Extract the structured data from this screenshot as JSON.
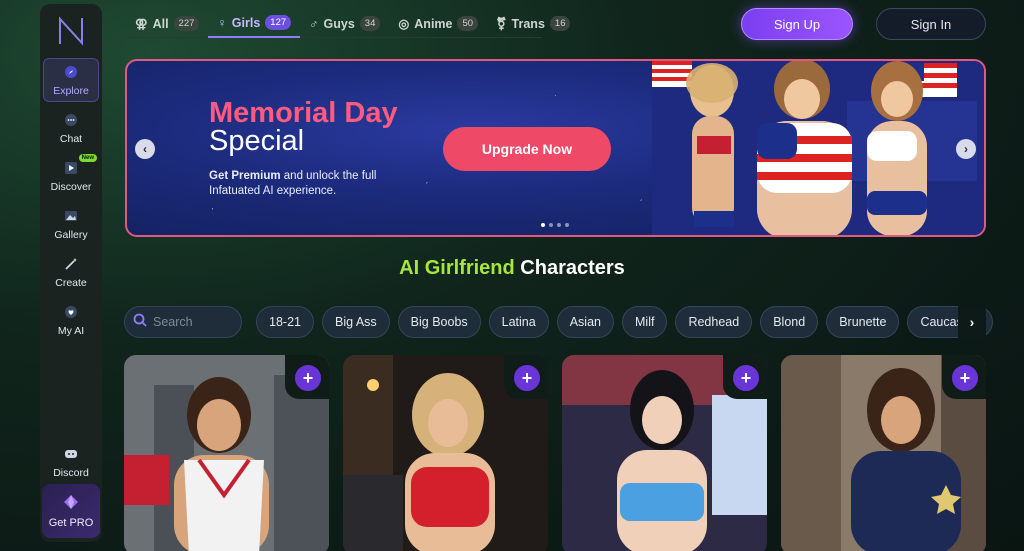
{
  "sidebar": {
    "items": [
      {
        "label": "Explore",
        "icon": "compass-icon",
        "active": true
      },
      {
        "label": "Chat",
        "icon": "chat-icon"
      },
      {
        "label": "Discover",
        "icon": "play-icon",
        "badge": "New"
      },
      {
        "label": "Gallery",
        "icon": "image-icon"
      },
      {
        "label": "Create",
        "icon": "wand-icon"
      },
      {
        "label": "My AI",
        "icon": "heart-chat-icon"
      }
    ],
    "discord_label": "Discord",
    "get_pro_label": "Get PRO"
  },
  "tabs": [
    {
      "label": "All",
      "count": "227",
      "icon": "all-gender-icon"
    },
    {
      "label": "Girls",
      "count": "127",
      "icon": "female-icon",
      "active": true
    },
    {
      "label": "Guys",
      "count": "34",
      "icon": "male-icon"
    },
    {
      "label": "Anime",
      "count": "50",
      "icon": "anime-icon"
    },
    {
      "label": "Trans",
      "count": "16",
      "icon": "trans-icon"
    }
  ],
  "header": {
    "signup_label": "Sign Up",
    "signin_label": "Sign In"
  },
  "banner": {
    "title_line1": "Memorial Day",
    "title_line2": "Special",
    "text_bold": "Get Premium",
    "text_rest": " and unlock the full Infatuated AI experience.",
    "cta_label": "Upgrade Now",
    "prev_label": "‹",
    "next_label": "›"
  },
  "section": {
    "title_highlight": "AI Girlfriend",
    "title_rest": " Characters"
  },
  "search": {
    "placeholder": "Search"
  },
  "filters": [
    "18-21",
    "Big Ass",
    "Big Boobs",
    "Latina",
    "Asian",
    "Milf",
    "Redhead",
    "Blond",
    "Brunette",
    "Caucasian"
  ],
  "filters_next": "›",
  "cards_plus": "+",
  "colors": {
    "accent_purple": "#7b3ff0",
    "accent_pink": "#ee4a68",
    "highlight_green": "#a8e63a"
  }
}
